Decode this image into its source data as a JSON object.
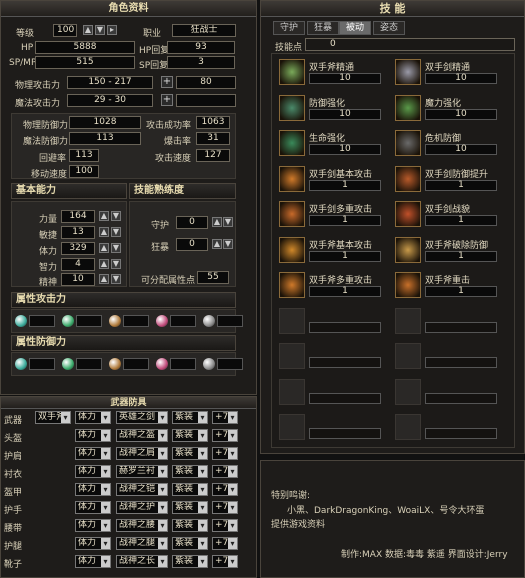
{
  "char": {
    "title": "角色资料",
    "level_label": "等级",
    "level": "100",
    "job_label": "职业",
    "job": "狂战士",
    "hp_label": "HP",
    "hp": "5888",
    "hp_regen_label": "HP回复",
    "hp_regen": "93",
    "spmp_label": "SP/MP",
    "spmp": "515",
    "sp_regen_label": "SP回复",
    "sp_regen": "3",
    "phys_atk_label": "物理攻击力",
    "phys_atk": "150 - 217",
    "phys_atk_bonus": "80",
    "mag_atk_label": "魔法攻击力",
    "mag_atk": "29 - 30",
    "mag_atk_bonus": "",
    "phys_def_label": "物理防御力",
    "phys_def": "1028",
    "hit_label": "攻击成功率",
    "hit": "1063",
    "mag_def_label": "魔法防御力",
    "mag_def": "113",
    "crit_label": "爆击率",
    "crit": "31",
    "dodge_label": "回避率",
    "dodge": "113",
    "atk_spd_label": "攻击速度",
    "atk_spd": "127",
    "move_label": "移动速度",
    "move": "100",
    "basic_title": "基本能力",
    "str_label": "力量",
    "str": "164",
    "vit_label": "敏捷",
    "vit": "13",
    "con_label": "体力",
    "con": "329",
    "int_label": "智力",
    "int": "4",
    "spi_label": "精神",
    "spi": "10",
    "prof_title": "技能熟练度",
    "guard_label": "守护",
    "guard": "0",
    "berserk_label": "狂暴",
    "berserk": "0",
    "free_label": "可分配属性点",
    "free": "55",
    "elem_atk_title": "属性攻击力",
    "elem_def_title": "属性防御力",
    "gem_colors": [
      "#3aaa9a",
      "#3aaa6a",
      "#b07a3a",
      "#c04a7a",
      "#8a8a8a"
    ]
  },
  "equip": {
    "title": "武器防具",
    "rows": [
      {
        "slot": "武器",
        "sub": "双手斧",
        "stat": "体力",
        "name": "英雄之剑",
        "grade": "紫装",
        "plus": "+7"
      },
      {
        "slot": "头盔",
        "sub": "",
        "stat": "体力",
        "name": "战神之盔",
        "grade": "紫装",
        "plus": "+7"
      },
      {
        "slot": "护肩",
        "sub": "",
        "stat": "体力",
        "name": "战神之肩",
        "grade": "紫装",
        "plus": "+7"
      },
      {
        "slot": "衬衣",
        "sub": "",
        "stat": "体力",
        "name": "赫罗兰衬",
        "grade": "紫装",
        "plus": "+7"
      },
      {
        "slot": "盔甲",
        "sub": "",
        "stat": "体力",
        "name": "战神之铠",
        "grade": "紫装",
        "plus": "+7"
      },
      {
        "slot": "护手",
        "sub": "",
        "stat": "体力",
        "name": "战神之护",
        "grade": "紫装",
        "plus": "+7"
      },
      {
        "slot": "腰带",
        "sub": "",
        "stat": "体力",
        "name": "战神之腰",
        "grade": "紫装",
        "plus": "+7"
      },
      {
        "slot": "护腿",
        "sub": "",
        "stat": "体力",
        "name": "战神之腿",
        "grade": "紫装",
        "plus": "+7"
      },
      {
        "slot": "靴子",
        "sub": "",
        "stat": "体力",
        "name": "战神之长",
        "grade": "紫装",
        "plus": "+7"
      }
    ]
  },
  "skills": {
    "title": "技  能",
    "tabs": [
      "守护",
      "狂暴",
      "被动",
      "姿态"
    ],
    "active_tab": 2,
    "points_label": "技能点",
    "points": "0",
    "list": [
      {
        "name": "双手斧精通",
        "value": "10",
        "color": "#7aaa5a"
      },
      {
        "name": "双手剑精通",
        "value": "10",
        "color": "#9a9aa8"
      },
      {
        "name": "防御强化",
        "value": "10",
        "color": "#4a8a6a"
      },
      {
        "name": "魔力强化",
        "value": "10",
        "color": "#5a9a4a"
      },
      {
        "name": "生命强化",
        "value": "10",
        "color": "#3a8a5a"
      },
      {
        "name": "危机防御",
        "value": "10",
        "color": "#6a6a6a"
      },
      {
        "name": "双手剑基本攻击",
        "value": "1",
        "color": "#d07a2a"
      },
      {
        "name": "双手剑防御提升",
        "value": "1",
        "color": "#b85a2a"
      },
      {
        "name": "双手剑多重攻击",
        "value": "1",
        "color": "#c86a2a"
      },
      {
        "name": "双手剑战貌",
        "value": "1",
        "color": "#c0502a"
      },
      {
        "name": "双手斧基本攻击",
        "value": "1",
        "color": "#d0882a"
      },
      {
        "name": "双手斧破除防御",
        "value": "1",
        "color": "#c89a4a"
      },
      {
        "name": "双手斧多重攻击",
        "value": "1",
        "color": "#d07a2a"
      },
      {
        "name": "双手斧重击",
        "value": "1",
        "color": "#c8702a"
      }
    ]
  },
  "credits": {
    "l1": "特别鸣谢:",
    "l2": "小黑、DarkDragonKing、WoaiLX、号令大环蛋",
    "l3": "提供游戏资料",
    "l4": "制作:MAX 数据:毒毒 紫遥 界面设计:Jerry"
  }
}
